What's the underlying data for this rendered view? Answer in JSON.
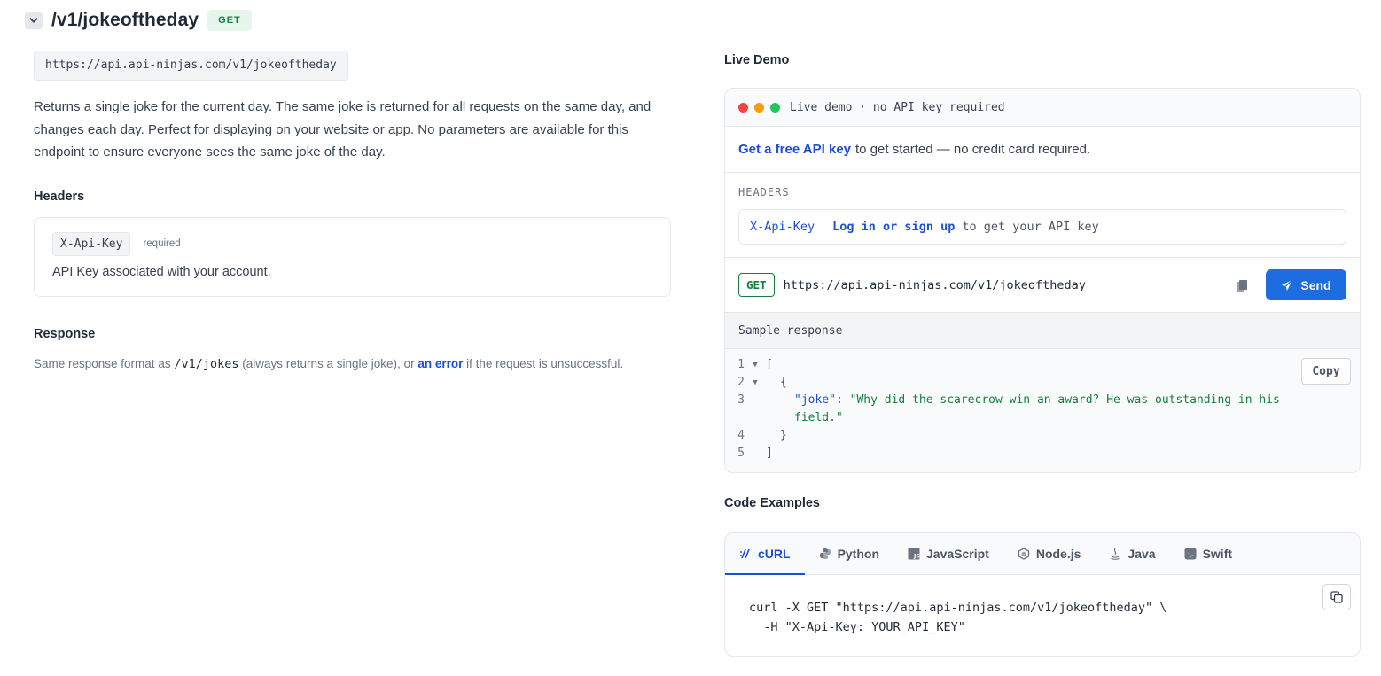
{
  "endpoint": {
    "path": "/v1/jokeoftheday",
    "method": "GET",
    "url": "https://api.api-ninjas.com/v1/jokeoftheday",
    "description": "Returns a single joke for the current day. The same joke is returned for all requests on the same day, and changes each day. Perfect for displaying on your website or app. No parameters are available for this endpoint to ensure everyone sees the same joke of the day."
  },
  "headers_section": {
    "title": "Headers",
    "key": "X-Api-Key",
    "required_label": "required",
    "key_description": "API Key associated with your account."
  },
  "response_section": {
    "title": "Response",
    "note_prefix": "Same response format as ",
    "note_code": "/v1/jokes",
    "note_middle": " (always returns a single joke), or ",
    "note_link": "an error",
    "note_suffix": " if the request is unsuccessful."
  },
  "live_demo": {
    "title": "Live Demo",
    "bar_text": "Live demo · no API key required",
    "apikey_link": "Get a free API key",
    "apikey_text": "to get started — no credit card required.",
    "headers_label": "HEADERS",
    "header_key": "X-Api-Key",
    "header_link": "Log in or sign up",
    "header_text": "to get your API key",
    "method": "GET",
    "url": "https://api.api-ninjas.com/v1/jokeoftheday",
    "send_label": "Send",
    "sample_label": "Sample response",
    "copy_label": "Copy",
    "response_lines": {
      "l1": "[",
      "l2": "{",
      "l3_key": "\"joke\"",
      "l3_colon": ": ",
      "l3_value": "\"Why did the scarecrow win an award? He was outstanding in his",
      "l3_cont": "field.\"",
      "l4": "}",
      "l5": "]"
    },
    "line_numbers": [
      "1",
      "2",
      "3",
      "4",
      "5"
    ],
    "traffic_colors": [
      "#ef4444",
      "#f59e0b",
      "#22c55e"
    ]
  },
  "code_examples": {
    "title": "Code Examples",
    "tabs": [
      {
        "label": "cURL",
        "icon": "terminal-slashes-icon"
      },
      {
        "label": "Python",
        "icon": "python-icon"
      },
      {
        "label": "JavaScript",
        "icon": "javascript-icon"
      },
      {
        "label": "Node.js",
        "icon": "nodejs-icon"
      },
      {
        "label": "Java",
        "icon": "java-icon"
      },
      {
        "label": "Swift",
        "icon": "swift-icon"
      }
    ],
    "active_tab": "cURL",
    "code": "curl -X GET \"https://api.api-ninjas.com/v1/jokeoftheday\" \\\n  -H \"X-Api-Key: YOUR_API_KEY\""
  },
  "colors": {
    "accent": "#1d4ed8",
    "send_button": "#1d6ce0",
    "get_green": "#15803d"
  }
}
